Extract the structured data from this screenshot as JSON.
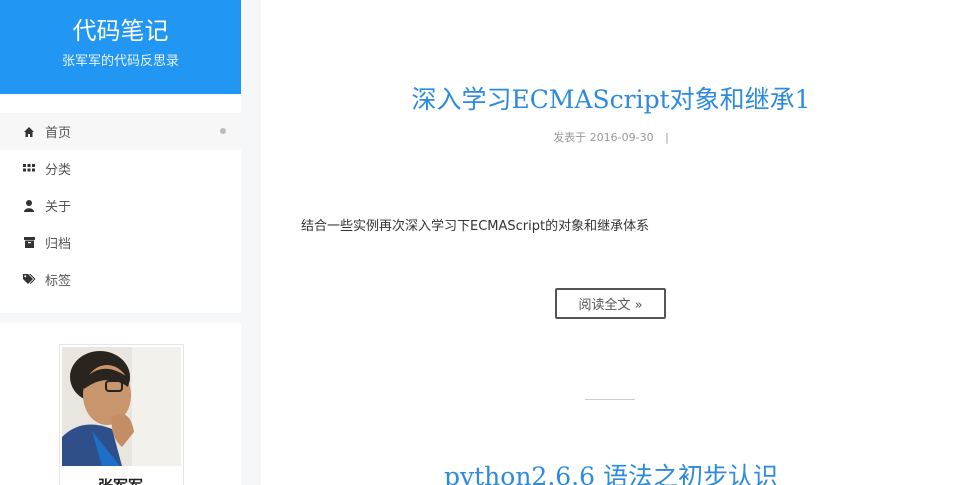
{
  "brand": {
    "title": "代码笔记",
    "subtitle": "张军军的代码反思录"
  },
  "menu": {
    "items": [
      {
        "label": "首页",
        "icon": "home-icon",
        "active": true
      },
      {
        "label": "分类",
        "icon": "grid-icon",
        "active": false
      },
      {
        "label": "关于",
        "icon": "user-icon",
        "active": false
      },
      {
        "label": "归档",
        "icon": "archive-icon",
        "active": false
      },
      {
        "label": "标签",
        "icon": "tags-icon",
        "active": false
      }
    ]
  },
  "profile": {
    "name": "张军军"
  },
  "posts": [
    {
      "title": "深入学习ECMAScript对象和继承1",
      "meta_prefix": "发表于",
      "date": "2016-09-30",
      "meta_separator": "|",
      "excerpt": "结合一些实例再次深入学习下ECMAScript的对象和继承体系",
      "read_more": "阅读全文 »"
    },
    {
      "title": "python2.6.6 语法之初步认识"
    }
  ],
  "colors": {
    "brand": "#2196f3",
    "title_link": "#2c8be0"
  }
}
